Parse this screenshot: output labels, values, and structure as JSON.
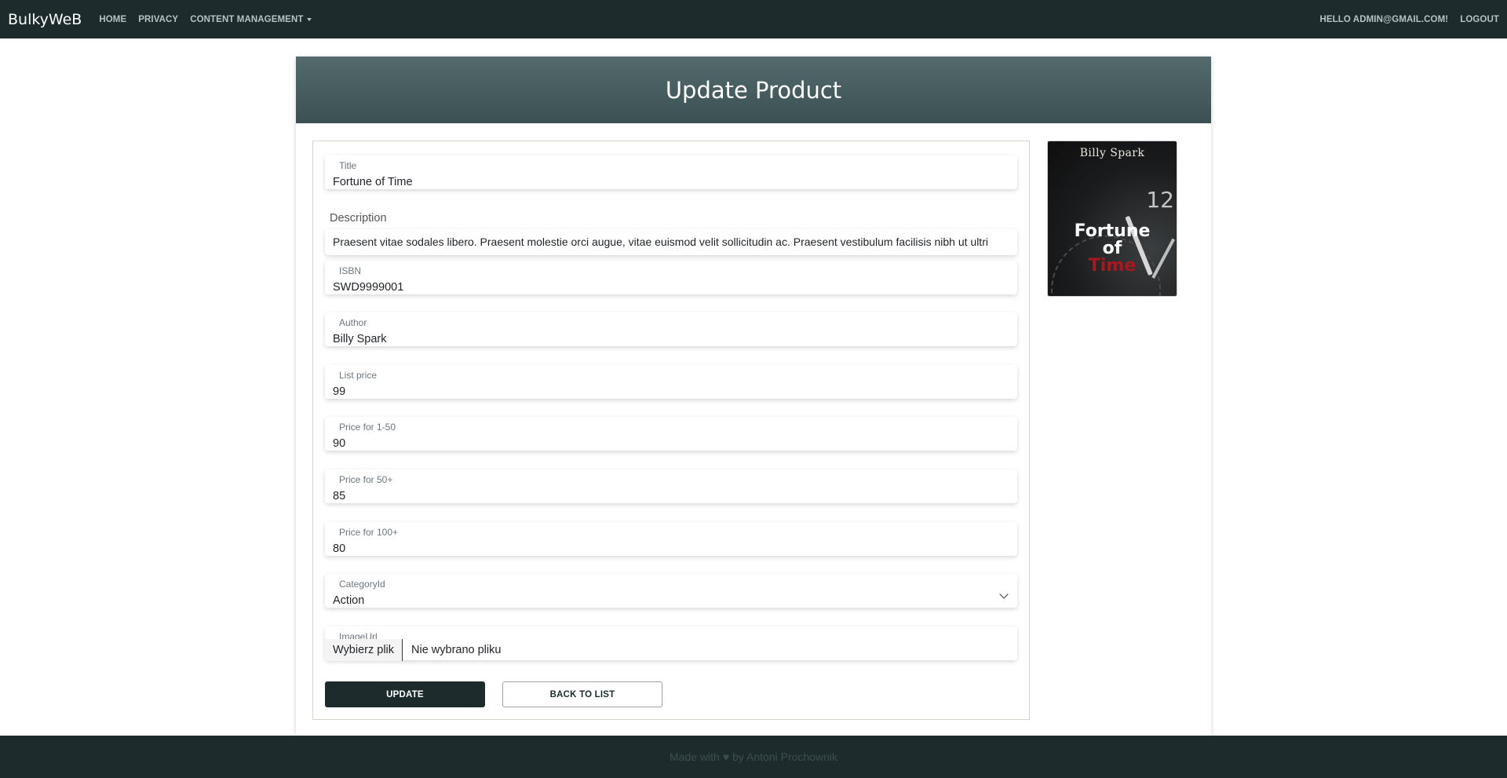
{
  "navbar": {
    "brand": "BulkyWeB",
    "links": [
      "HOME",
      "PRIVACY",
      "CONTENT MANAGEMENT"
    ],
    "greeting": "HELLO ADMIN@GMAIL.COM!",
    "logout": "LOGOUT"
  },
  "page": {
    "title": "Update Product"
  },
  "form": {
    "title": {
      "label": "Title",
      "value": "Fortune of Time"
    },
    "description": {
      "label": "Description",
      "value": "Praesent vitae sodales libero. Praesent molestie orci augue, vitae euismod velit sollicitudin ac. Praesent vestibulum facilisis nibh ut ultri"
    },
    "isbn": {
      "label": "ISBN",
      "value": "SWD9999001"
    },
    "author": {
      "label": "Author",
      "value": "Billy Spark"
    },
    "list_price": {
      "label": "List price",
      "value": "99"
    },
    "price_1_50": {
      "label": "Price for 1-50",
      "value": "90"
    },
    "price_50": {
      "label": "Price for 50+",
      "value": "85"
    },
    "price_100": {
      "label": "Price for 100+",
      "value": "80"
    },
    "category": {
      "label": "CategoryId",
      "value": "Action"
    },
    "image": {
      "label": "ImageUrl",
      "button": "Wybierz plik",
      "file_text": "Nie wybrano pliku"
    }
  },
  "buttons": {
    "update": "UPDATE",
    "back": "BACK TO LIST"
  },
  "cover": {
    "author": "Billy Spark",
    "line1": "Fortune",
    "line2": "of",
    "line3": "Time",
    "number": "12"
  },
  "footer": {
    "before": "Made with",
    "icon": "heart-icon",
    "after": "by Antoni Prochownik"
  },
  "colors": {
    "nav": "#1d2b2c",
    "header_top": "#546b6e",
    "header_bottom": "#3a5053",
    "primary_button": "#1d2b2c"
  }
}
